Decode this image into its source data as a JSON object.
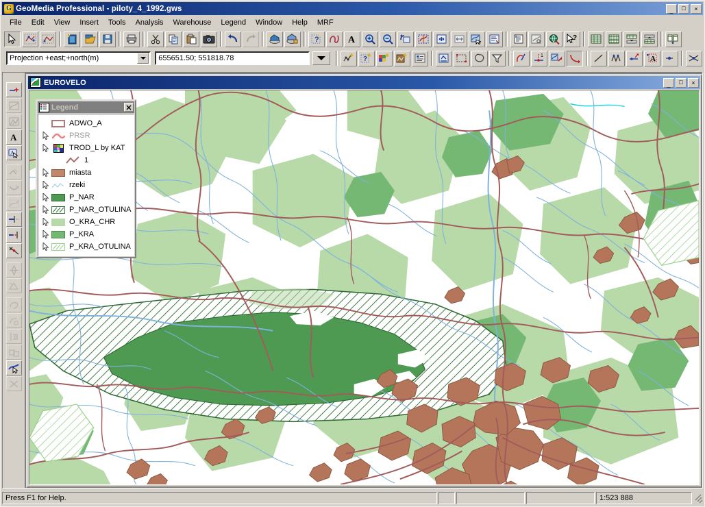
{
  "window": {
    "title": "GeoMedia Professional - piloty_4_1992.gws",
    "app_icon": "geomedia-globe-icon",
    "minimize_label": "_",
    "maximize_label": "□",
    "close_label": "×"
  },
  "menu": {
    "items": [
      {
        "label": "File"
      },
      {
        "label": "Edit"
      },
      {
        "label": "View"
      },
      {
        "label": "Insert"
      },
      {
        "label": "Tools"
      },
      {
        "label": "Analysis"
      },
      {
        "label": "Warehouse"
      },
      {
        "label": "Legend"
      },
      {
        "label": "Window"
      },
      {
        "label": "Help"
      },
      {
        "label": "MRF"
      }
    ]
  },
  "toolbar_main": {
    "buttons": [
      {
        "name": "select-tool",
        "icon": "arrow-cursor-icon",
        "state": "pressed"
      },
      {
        "name": "select-by-fence-tool",
        "icon": "select-fence-icon",
        "state": "normal"
      },
      {
        "name": "select-area-tool",
        "icon": "select-area-icon",
        "state": "normal"
      },
      {
        "name": "new-geoworkspace",
        "icon": "new-document-icon",
        "state": "normal"
      },
      {
        "name": "open-geoworkspace",
        "icon": "open-folder-icon",
        "state": "normal"
      },
      {
        "name": "save-geoworkspace",
        "icon": "save-disk-icon",
        "state": "normal"
      },
      {
        "name": "print",
        "icon": "printer-icon",
        "state": "normal"
      },
      {
        "name": "cut",
        "icon": "scissors-icon",
        "state": "normal"
      },
      {
        "name": "copy",
        "icon": "copy-pages-icon",
        "state": "normal"
      },
      {
        "name": "paste",
        "icon": "clipboard-icon",
        "state": "normal"
      },
      {
        "name": "capture-image",
        "icon": "camera-icon",
        "state": "normal"
      },
      {
        "name": "undo",
        "icon": "undo-arrow-icon",
        "state": "normal"
      },
      {
        "name": "redo",
        "icon": "redo-arrow-icon",
        "state": "disabled"
      },
      {
        "name": "new-connection",
        "icon": "warehouse-connection-icon",
        "state": "normal"
      },
      {
        "name": "define-warehouse",
        "icon": "warehouse-key-icon",
        "state": "normal"
      },
      {
        "name": "new-query",
        "icon": "query-wizard-icon",
        "state": "normal"
      },
      {
        "name": "spatial-query",
        "icon": "spatial-filter-icon",
        "state": "normal"
      },
      {
        "name": "insert-text",
        "icon": "text-a-icon",
        "state": "normal"
      },
      {
        "name": "zoom-in",
        "icon": "magnifier-plus-icon",
        "state": "normal"
      },
      {
        "name": "zoom-out",
        "icon": "magnifier-minus-icon",
        "state": "normal"
      },
      {
        "name": "previous-view",
        "icon": "previous-view-icon",
        "state": "normal"
      },
      {
        "name": "fit-all",
        "icon": "fit-world-icon",
        "state": "normal"
      },
      {
        "name": "zoom-to-extent",
        "icon": "zoom-extent-icon",
        "state": "normal"
      },
      {
        "name": "zoom-width",
        "icon": "zoom-width-icon",
        "state": "normal"
      },
      {
        "name": "pan",
        "icon": "pan-hand-icon",
        "state": "normal"
      },
      {
        "name": "display-properties",
        "icon": "display-props-icon",
        "state": "normal"
      },
      {
        "name": "feature-properties",
        "icon": "properties-sheet-icon",
        "state": "normal"
      },
      {
        "name": "attribute-view",
        "icon": "attribute-table-icon",
        "state": "normal"
      },
      {
        "name": "locate-feature",
        "icon": "globe-search-icon",
        "state": "normal"
      },
      {
        "name": "context-help",
        "icon": "help-arrow-icon",
        "state": "normal"
      },
      {
        "name": "data-window",
        "icon": "grid-table-icon",
        "state": "normal"
      },
      {
        "name": "detail-window",
        "icon": "grid-detail-icon",
        "state": "normal"
      },
      {
        "name": "export-up",
        "icon": "export-up-icon",
        "state": "normal"
      },
      {
        "name": "import-down",
        "icon": "import-down-icon",
        "state": "normal"
      },
      {
        "name": "merge-tables",
        "icon": "merge-tables-icon",
        "state": "normal"
      }
    ]
  },
  "toolbar_secondary": {
    "projection": {
      "label": "Projection +east;+north(m)",
      "name": "projection-select"
    },
    "coordinates": {
      "value": "655651.50; 551818.78",
      "name": "coordinate-readout"
    },
    "dropdown_name": "coordinate-mode-dropdown",
    "buttons": [
      {
        "name": "insert-point-feature",
        "icon": "add-point-icon"
      },
      {
        "name": "insert-query-feature",
        "icon": "add-query-icon"
      },
      {
        "name": "insert-thematic-feature",
        "icon": "add-thematic-icon"
      },
      {
        "name": "insert-image-feature",
        "icon": "add-image-icon"
      },
      {
        "name": "legend-entry-properties",
        "icon": "legend-props-icon"
      },
      {
        "name": "select-set-tool",
        "icon": "select-set-icon"
      },
      {
        "name": "select-rectangle-tool",
        "icon": "select-rect-icon"
      },
      {
        "name": "select-polygon-tool",
        "icon": "select-poly-icon"
      },
      {
        "name": "select-by-attribute",
        "icon": "select-attribute-icon"
      },
      {
        "name": "edit-geometry",
        "icon": "edit-geometry-icon"
      },
      {
        "name": "insert-vertex",
        "icon": "insert-vertex-icon"
      },
      {
        "name": "move-feature",
        "icon": "move-feature-icon"
      },
      {
        "name": "delete-geometry",
        "icon": "delete-geometry-icon"
      },
      {
        "name": "place-line",
        "icon": "place-line-icon"
      },
      {
        "name": "place-polyline",
        "icon": "place-polyline-icon"
      },
      {
        "name": "place-arc",
        "icon": "place-arc-icon"
      },
      {
        "name": "place-text",
        "icon": "place-text-icon"
      },
      {
        "name": "place-point",
        "icon": "place-point-icon"
      },
      {
        "name": "delete-feature",
        "icon": "delete-x-icon"
      }
    ]
  },
  "toolbar_vertical": {
    "buttons": [
      {
        "name": "place-point-tool",
        "icon": "point-plus-icon",
        "state": "normal"
      },
      {
        "name": "place-area-tool",
        "icon": "area-tool-icon",
        "state": "disabled"
      },
      {
        "name": "place-compound-tool",
        "icon": "compound-tool-icon",
        "state": "disabled"
      },
      {
        "name": "place-text-tool",
        "icon": "text-a-icon",
        "state": "normal"
      },
      {
        "name": "edit-text-tool",
        "icon": "edit-text-icon",
        "state": "pressed"
      },
      {
        "name": "split-line-tool",
        "icon": "split-line-icon",
        "state": "disabled"
      },
      {
        "name": "extend-line-tool",
        "icon": "extend-line-icon",
        "state": "disabled"
      },
      {
        "name": "smooth-line-tool",
        "icon": "smooth-line-icon",
        "state": "disabled"
      },
      {
        "name": "trim-line-tool",
        "icon": "trim-line-icon",
        "state": "normal"
      },
      {
        "name": "extend-to-tool",
        "icon": "extend-to-icon",
        "state": "normal"
      },
      {
        "name": "intersect-tool",
        "icon": "intersect-x-icon",
        "state": "normal"
      },
      {
        "name": "rotate-tool",
        "icon": "rotate-tool-icon",
        "state": "disabled"
      },
      {
        "name": "move-vertex-tool",
        "icon": "move-vertex-icon",
        "state": "disabled"
      },
      {
        "name": "copy-parallel-tool",
        "icon": "copy-parallel-icon",
        "state": "disabled"
      },
      {
        "name": "fillet-tool",
        "icon": "fillet-icon",
        "state": "disabled"
      },
      {
        "name": "construct-tool",
        "icon": "construct-icon",
        "state": "disabled"
      },
      {
        "name": "merge-tool",
        "icon": "merge-icon",
        "state": "disabled"
      },
      {
        "name": "select-edit-tool",
        "icon": "select-edit-icon",
        "state": "normal"
      },
      {
        "name": "delete-tool",
        "icon": "delete-x-icon",
        "state": "disabled"
      }
    ]
  },
  "map_window": {
    "title": "EUROVELO",
    "icon": "map-window-icon",
    "minimize_label": "_",
    "restore_label": "□",
    "close_label": "×"
  },
  "legend": {
    "title": "Legend",
    "icon": "legend-list-icon",
    "close_label": "×",
    "entries": [
      {
        "label": "ADWO_A",
        "swatch": "area-outline-swatch",
        "cursor": false,
        "sub": false,
        "dim": false,
        "fill": "#ffffff",
        "stroke": "#b07878"
      },
      {
        "label": "PRSR",
        "swatch": "line-zigzag-swatch",
        "cursor": true,
        "sub": false,
        "dim": true,
        "stroke": "#f08080"
      },
      {
        "label": "TROD_L by KAT",
        "swatch": "thematic-palette-swatch",
        "cursor": true,
        "sub": false,
        "dim": false
      },
      {
        "label": "1",
        "swatch": "line-zigzag-swatch",
        "cursor": false,
        "sub": true,
        "dim": false,
        "stroke": "#a87070"
      },
      {
        "label": "miasta",
        "swatch": "area-fill-swatch",
        "cursor": true,
        "sub": false,
        "dim": false,
        "fill": "#c08868",
        "stroke": "#8a5a40"
      },
      {
        "label": "rzeki",
        "swatch": "line-thin-swatch",
        "cursor": true,
        "sub": false,
        "dim": false,
        "stroke": "#a8c8e8"
      },
      {
        "label": "P_NAR",
        "swatch": "area-fill-swatch",
        "cursor": true,
        "sub": false,
        "dim": false,
        "fill": "#4f9a52",
        "stroke": "#2f6a35"
      },
      {
        "label": "P_NAR_OTULINA",
        "swatch": "area-hatch-swatch",
        "cursor": true,
        "sub": false,
        "dim": false,
        "fill": "#ffffff",
        "stroke": "#3f7a42"
      },
      {
        "label": "O_KRA_CHR",
        "swatch": "area-fill-swatch",
        "cursor": true,
        "sub": false,
        "dim": false,
        "fill": "#b8d9a8",
        "stroke": "#b8d9a8"
      },
      {
        "label": "P_KRA",
        "swatch": "area-fill-swatch",
        "cursor": true,
        "sub": false,
        "dim": false,
        "fill": "#74b874",
        "stroke": "#4f8a50"
      },
      {
        "label": "P_KRA_OTULINA",
        "swatch": "area-hatch-swatch",
        "cursor": true,
        "sub": false,
        "dim": false,
        "fill": "#ffffff",
        "stroke": "#9ccf8c"
      }
    ]
  },
  "statusbar": {
    "help_text": "Press F1 for Help.",
    "cell1": "",
    "cell2": "",
    "cell3": "",
    "scale": "1:523 888"
  },
  "colors": {
    "title_blue": "#0a246a",
    "face": "#d4d0c8",
    "park_dark_green": "#4f9a52",
    "park_mid_green": "#74b874",
    "protected_light_green": "#b8d9a8",
    "urban_brown": "#b5755a",
    "road_red": "#a35a5a",
    "river_blue": "#7fb2dd",
    "map_background": "#ffffff"
  }
}
